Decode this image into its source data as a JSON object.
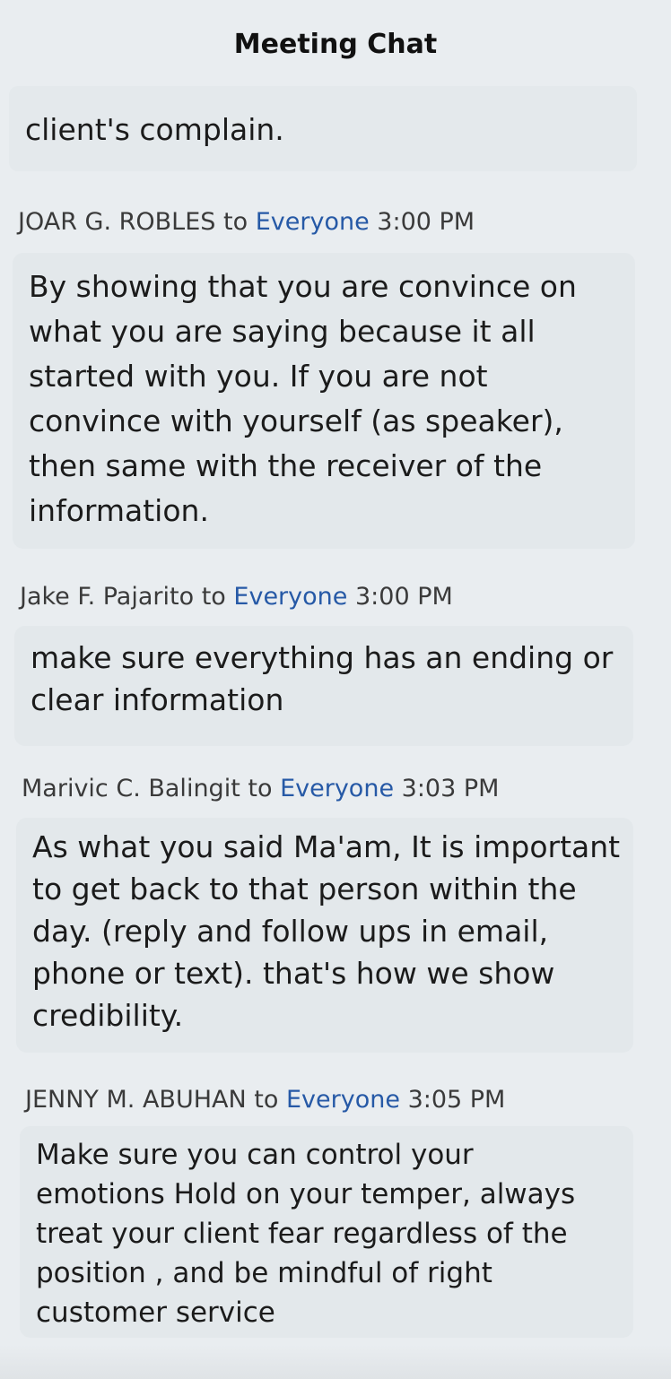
{
  "header": {
    "title": "Meeting Chat"
  },
  "partial_message": {
    "text": "client's complain."
  },
  "messages": [
    {
      "sender": "JOAR G. ROBLES",
      "to_word": "to",
      "target": "Everyone",
      "time": "3:00 PM",
      "text": "By showing that you are convince on\nwhat you are saying because it all\nstarted with you. If you are not\nconvince with yourself (as speaker),\nthen same with the receiver of the\ninformation."
    },
    {
      "sender": "Jake F. Pajarito",
      "to_word": "to",
      "target": "Everyone",
      "time": "3:00 PM",
      "text": "make sure everything has an ending or\nclear information"
    },
    {
      "sender": "Marivic C. Balingit",
      "to_word": "to",
      "target": "Everyone",
      "time": "3:03 PM",
      "text": "As what you said Ma'am, It is important\nto get back to that person within the\nday.  (reply and follow ups in email,\nphone or text). that's how we show\ncredibility."
    },
    {
      "sender": "JENNY M. ABUHAN",
      "to_word": "to",
      "target": "Everyone",
      "time": "3:05 PM",
      "text": "Make sure you can control your\nemotions Hold on your temper, always\ntreat your client fear regardless of the\nposition , and be mindful of right\ncustomer service"
    }
  ],
  "colors": {
    "background": "#e9edf0",
    "bubble": "#e3e8eb",
    "recipient_link": "#2659a6"
  }
}
